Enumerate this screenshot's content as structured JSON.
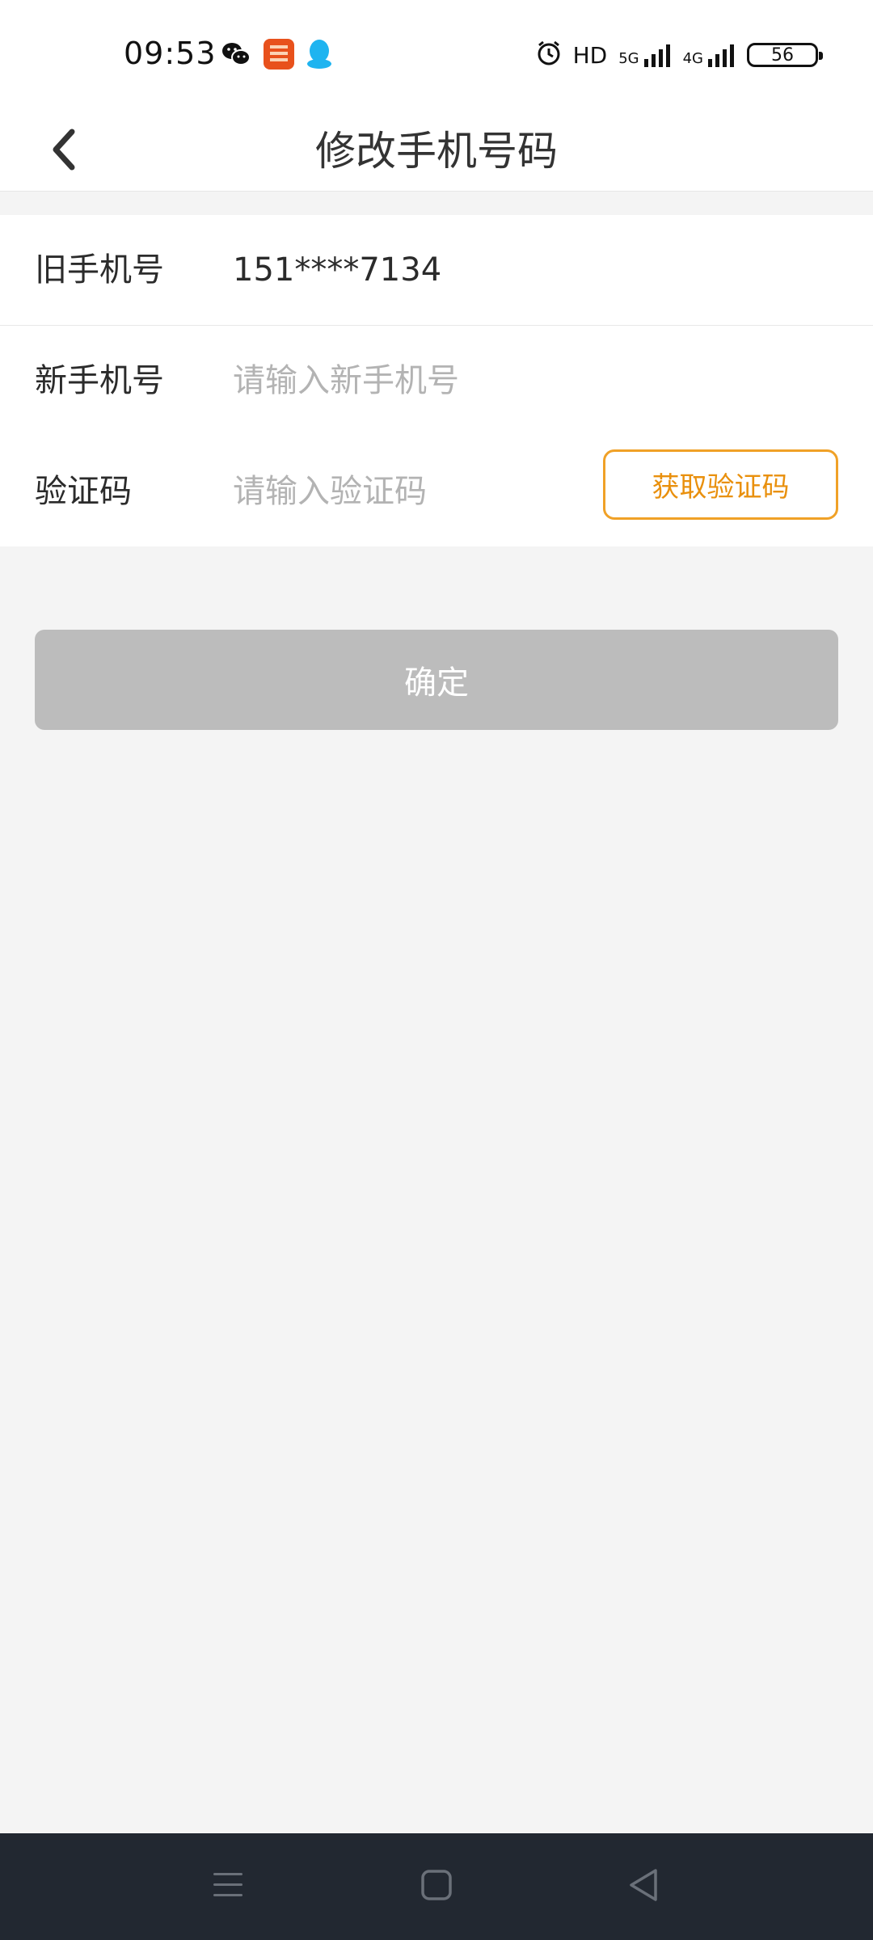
{
  "status_bar": {
    "time": "09:53",
    "app_icons": [
      "wechat-icon",
      "bank-app-icon",
      "qq-icon"
    ],
    "right_items": {
      "alarm_icon": "alarm-icon",
      "hd_label": "HD",
      "signal_5g_label": "5G",
      "signal_4g_label": "4G",
      "battery_level": "56"
    }
  },
  "header": {
    "title": "修改手机号码",
    "back_icon": "chevron-left-icon"
  },
  "form": {
    "old_phone": {
      "label": "旧手机号",
      "value": "151****7134"
    },
    "new_phone": {
      "label": "新手机号",
      "placeholder": "请输入新手机号",
      "value": ""
    },
    "verification": {
      "label": "验证码",
      "placeholder": "请输入验证码",
      "value": "",
      "button_label": "获取验证码"
    }
  },
  "confirm_button": {
    "label": "确定"
  },
  "system_nav": {
    "menu_icon": "menu-icon",
    "home_icon": "home-square-icon",
    "back_icon": "back-triangle-icon"
  },
  "colors": {
    "accent": "#f0a127",
    "disabled_button": "#bcbcbc",
    "background": "#f4f4f4",
    "nav_bar": "#222831"
  }
}
